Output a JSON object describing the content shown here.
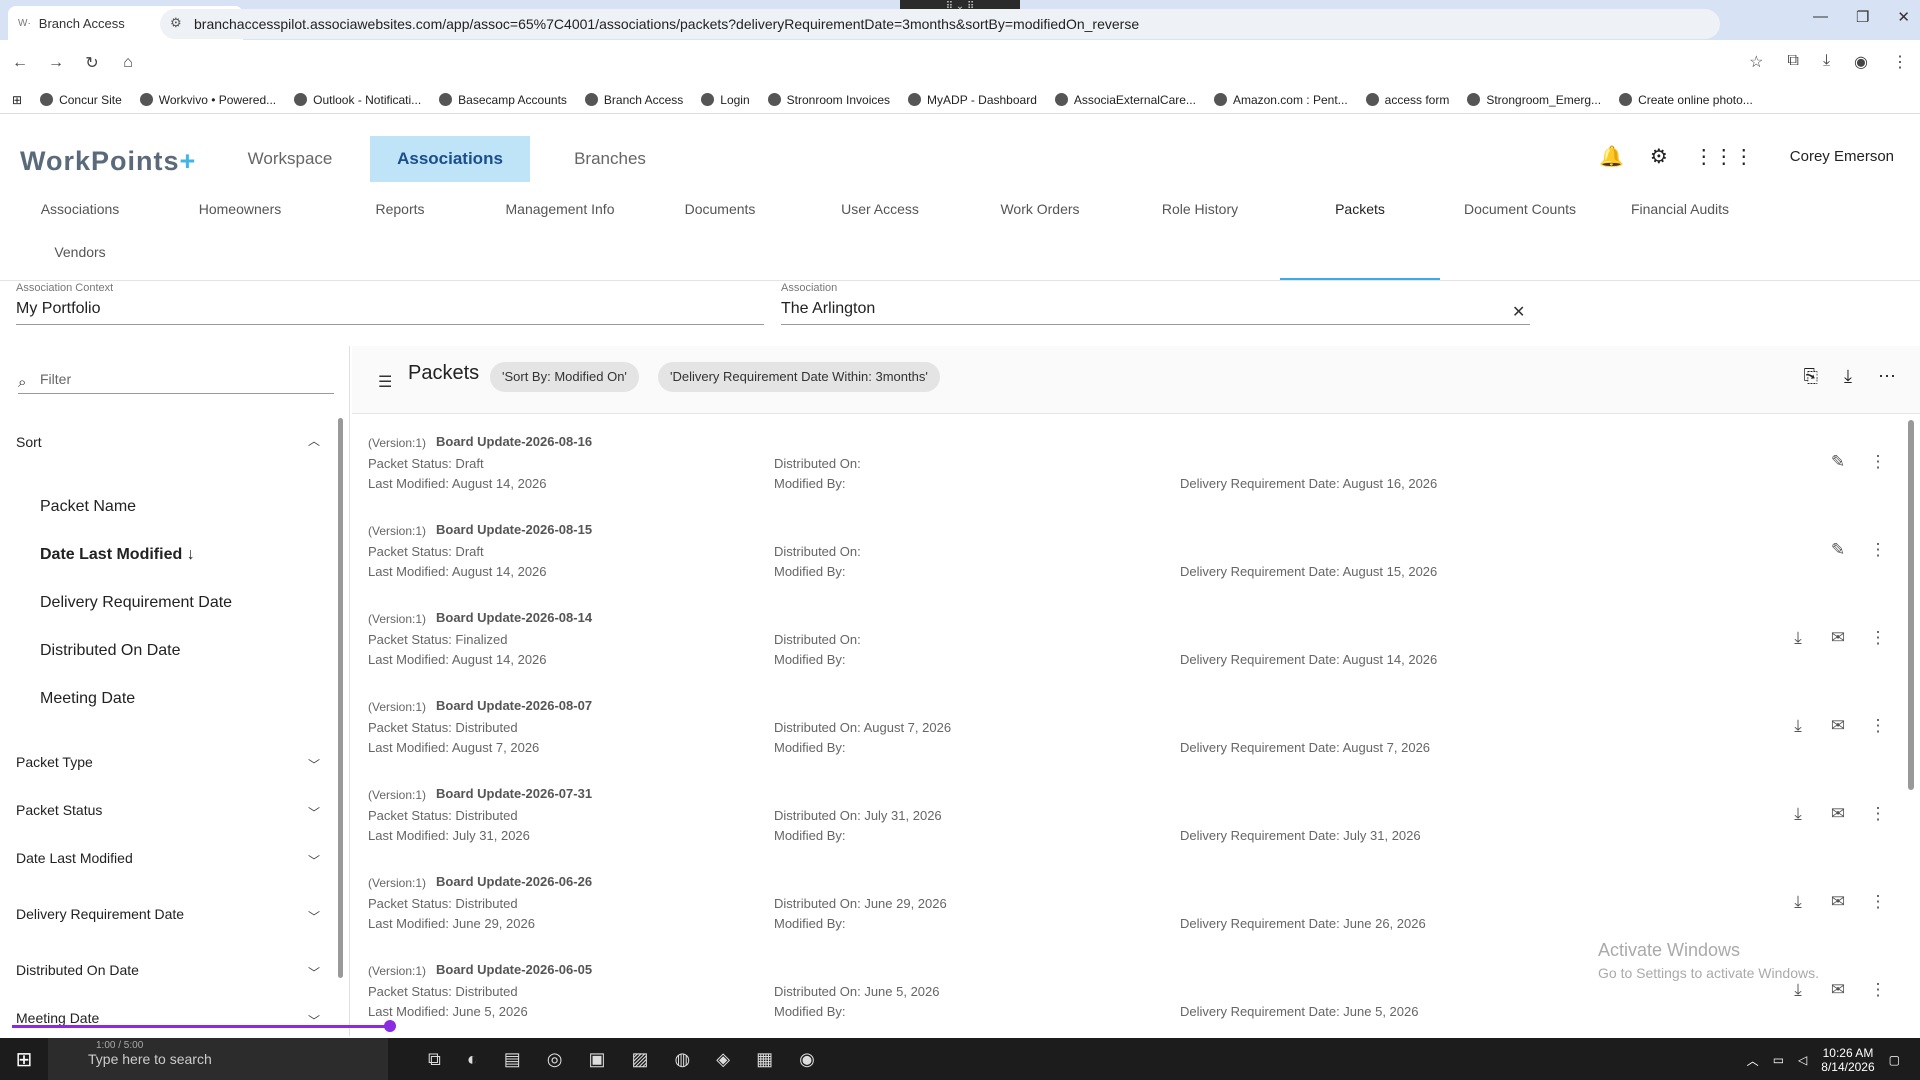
{
  "browser": {
    "tab_title": "Branch Access",
    "url": "branchaccesspilot.associawebsites.com/app/assoc=65%7C4001/associations/packets?deliveryRequirementDate=3months&sortBy=modifiedOn_reverse",
    "bookmarks": [
      "Concur Site",
      "Workvivo • Powered...",
      "Outlook - Notificati...",
      "Basecamp Accounts",
      "Branch Access",
      "Login",
      "Stronroom Invoices",
      "MyADP - Dashboard",
      "AssociaExternalCare...",
      "Amazon.com : Pent...",
      "access form",
      "Strongroom_Emerg...",
      "Create online photo..."
    ]
  },
  "app": {
    "logo": "WorkPoints",
    "logo_plus": "+",
    "topnav": [
      "Workspace",
      "Associations",
      "Branches"
    ],
    "user": "Corey Emerson",
    "subnav": [
      "Associations",
      "Homeowners",
      "Reports",
      "Management Info",
      "Documents",
      "User Access",
      "Work Orders",
      "Role History",
      "Packets",
      "Document Counts",
      "Financial Audits"
    ],
    "subnav_row2": [
      "Vendors"
    ],
    "association_context_label": "Association Context",
    "association_context_value": "My Portfolio",
    "association_label": "Association",
    "association_value": "The Arlington"
  },
  "left_panel": {
    "filter_placeholder": "Filter",
    "sort_label": "Sort",
    "sort_options": [
      "Packet Name",
      "Date Last Modified",
      "Delivery Requirement Date",
      "Distributed On Date",
      "Meeting Date"
    ],
    "sort_selected_arrow": "↓",
    "filters": [
      "Packet Type",
      "Packet Status",
      "Date Last Modified",
      "Delivery Requirement Date",
      "Distributed On Date",
      "Meeting Date"
    ]
  },
  "toolbar": {
    "title": "Packets",
    "chip1": "'Sort By: Modified On'",
    "chip2": "'Delivery Requirement Date Within: 3months'"
  },
  "packets": [
    {
      "version": "(Version:1)",
      "name": "Board Update-2026-08-16",
      "status": "Packet Status: Draft",
      "modified": "Last Modified: August 14, 2026",
      "distributed": "Distributed On:",
      "modified_by": "Modified By:",
      "delivery": "Delivery Requirement Date: August 16, 2026",
      "actions": "draft"
    },
    {
      "version": "(Version:1)",
      "name": "Board Update-2026-08-15",
      "status": "Packet Status: Draft",
      "modified": "Last Modified: August 14, 2026",
      "distributed": "Distributed On:",
      "modified_by": "Modified By:",
      "delivery": "Delivery Requirement Date: August 15, 2026",
      "actions": "draft"
    },
    {
      "version": "(Version:1)",
      "name": "Board Update-2026-08-14",
      "status": "Packet Status: Finalized",
      "modified": "Last Modified: August 14, 2026",
      "distributed": "Distributed On:",
      "modified_by": "Modified By:",
      "delivery": "Delivery Requirement Date: August 14, 2026",
      "actions": "final"
    },
    {
      "version": "(Version:1)",
      "name": "Board Update-2026-08-07",
      "status": "Packet Status: Distributed",
      "modified": "Last Modified: August 7, 2026",
      "distributed": "Distributed On: August 7, 2026",
      "modified_by": "Modified By:",
      "delivery": "Delivery Requirement Date: August 7, 2026",
      "actions": "final"
    },
    {
      "version": "(Version:1)",
      "name": "Board Update-2026-07-31",
      "status": "Packet Status: Distributed",
      "modified": "Last Modified: July 31, 2026",
      "distributed": "Distributed On: July 31, 2026",
      "modified_by": "Modified By:",
      "delivery": "Delivery Requirement Date: July 31, 2026",
      "actions": "final"
    },
    {
      "version": "(Version:1)",
      "name": "Board Update-2026-06-26",
      "status": "Packet Status: Distributed",
      "modified": "Last Modified: June 29, 2026",
      "distributed": "Distributed On: June 29, 2026",
      "modified_by": "Modified By:",
      "delivery": "Delivery Requirement Date: June 26, 2026",
      "actions": "final"
    },
    {
      "version": "(Version:1)",
      "name": "Board Update-2026-06-05",
      "status": "Packet Status: Distributed",
      "modified": "Last Modified: June 5, 2026",
      "distributed": "Distributed On: June 5, 2026",
      "modified_by": "Modified By:",
      "delivery": "Delivery Requirement Date: June 5, 2026",
      "actions": "final"
    }
  ],
  "watermark": {
    "line1": "Activate Windows",
    "line2": "Go to Settings to activate Windows."
  },
  "taskbar": {
    "search_placeholder": "Type here to search",
    "media_time": "1:00 / 5:00",
    "time": "10:26 AM",
    "date": "8/14/2026"
  }
}
